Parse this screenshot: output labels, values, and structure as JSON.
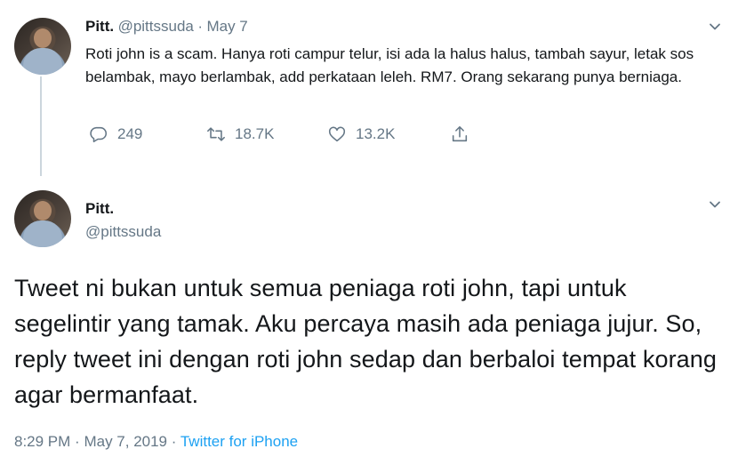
{
  "tweet1": {
    "name": "Pitt.",
    "handle": "@pittssuda",
    "separator": "·",
    "date": "May 7",
    "text": "Roti john is a scam. Hanya roti campur telur, isi ada la halus halus, tambah sayur, letak sos belambak, mayo berlambak, add perkataan leleh. RM7. Orang sekarang punya berniaga.",
    "replies": "249",
    "retweets": "18.7K",
    "likes": "13.2K"
  },
  "tweet2": {
    "name": "Pitt.",
    "handle": "@pittssuda",
    "text": "Tweet ni bukan untuk semua peniaga roti john, tapi untuk segelintir yang tamak. Aku percaya masih ada peniaga jujur. So, reply tweet ini dengan roti john sedap dan berbaloi tempat korang agar bermanfaat.",
    "time": "8:29 PM",
    "date": "May 7, 2019",
    "separator": "·",
    "source": "Twitter for iPhone"
  },
  "colors": {
    "text": "#14171a",
    "secondary": "#657786",
    "link": "#1da1f2",
    "thread_line": "#ccd6dd"
  },
  "icons": [
    "reply-icon",
    "retweet-icon",
    "like-icon",
    "share-icon",
    "chevron-down-icon"
  ]
}
